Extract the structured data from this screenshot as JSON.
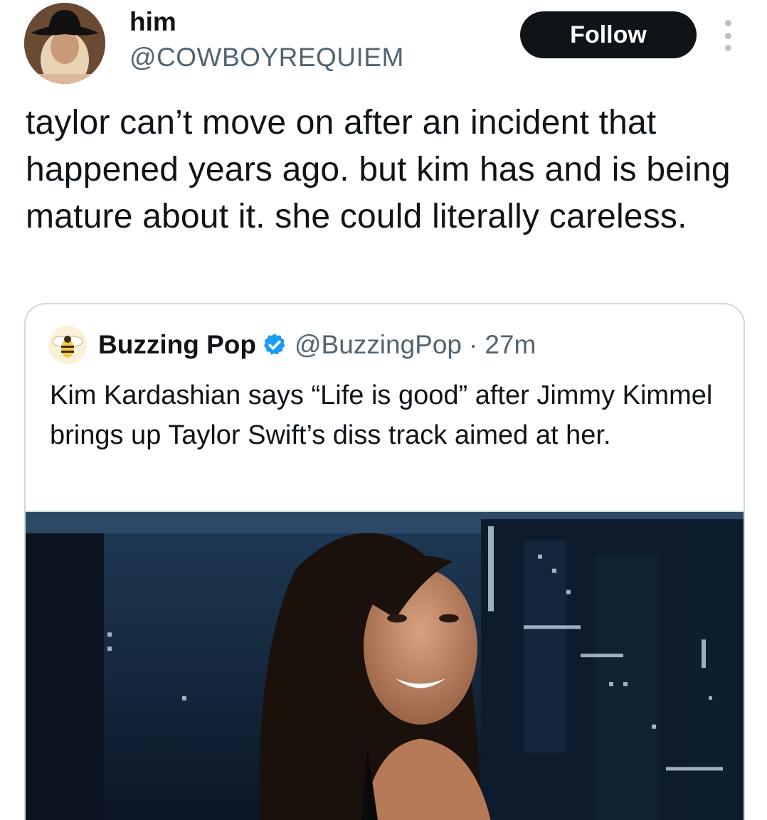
{
  "author": {
    "display_name": "him",
    "handle": "@COWBOYREQUIEM",
    "avatar": "avatar-photo-cowboy-hat"
  },
  "follow_label": "Follow",
  "more_icon": "more-vertical-icon",
  "tweet": {
    "text": "taylor can’t move on after an incident that happened years ago. but kim has and is being mature about it. she could literally careless."
  },
  "quoted_tweet": {
    "display_name": "Buzzing Pop",
    "verified": true,
    "handle": "@BuzzingPop",
    "separator": "·",
    "time": "27m",
    "text": "Kim Kardashian says “Life is good” after Jimmy Kimmel brings up Taylor Swift’s diss track aimed at her.",
    "avatar": "bee-logo-icon",
    "media": "photo-woman-talk-show-city-backdrop"
  },
  "colors": {
    "text_primary": "#0f1419",
    "text_secondary": "#536471",
    "button_bg": "#0f1419",
    "border": "#cfd9de",
    "verified_blue": "#1d9bf0"
  }
}
